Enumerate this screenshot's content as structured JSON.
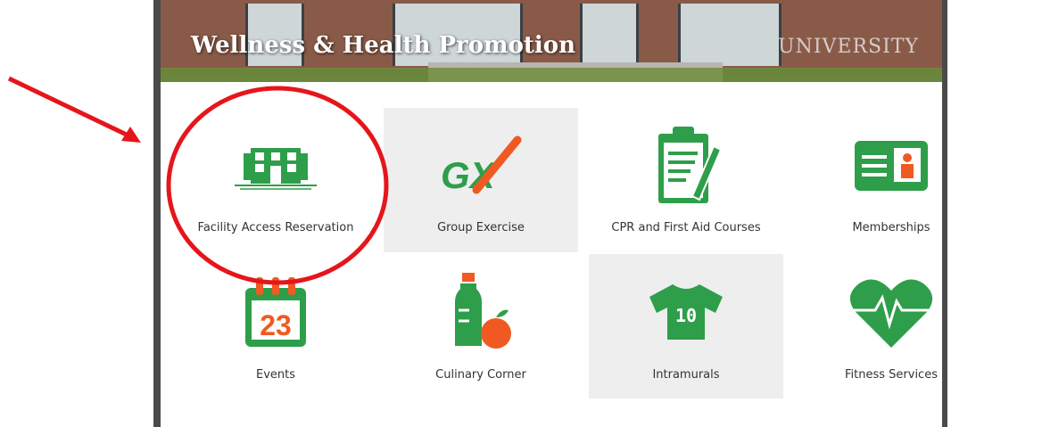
{
  "header": {
    "title": "Wellness & Health Promotion",
    "logo_text": "UNIVERSITY"
  },
  "tiles": [
    {
      "label": "Facility Access Reservation",
      "icon": "building-icon"
    },
    {
      "label": "Group Exercise",
      "icon": "gx-icon",
      "icon_text": "GX"
    },
    {
      "label": "CPR and First Aid Courses",
      "icon": "clipboard-icon"
    },
    {
      "label": "Memberships",
      "icon": "id-card-icon"
    },
    {
      "label": "Events",
      "icon": "calendar-icon",
      "icon_text": "23"
    },
    {
      "label": "Culinary Corner",
      "icon": "water-bottle-apple-icon"
    },
    {
      "label": "Intramurals",
      "icon": "jersey-icon",
      "icon_text": "10"
    },
    {
      "label": "Fitness Services",
      "icon": "heart-pulse-icon"
    }
  ],
  "colors": {
    "green": "#2e9e4a",
    "orange": "#f05a22",
    "annotation_red": "#e5161b"
  }
}
